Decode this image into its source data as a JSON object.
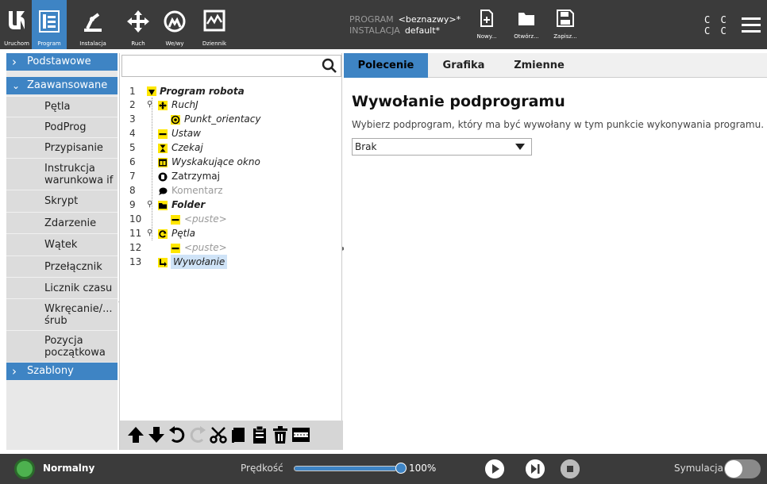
{
  "topbar": {
    "buttons": [
      {
        "label": "Uruchom",
        "icon": "ur-logo-icon"
      },
      {
        "label": "Program",
        "icon": "program-tree-icon",
        "active": true
      },
      {
        "label": "Instalacja",
        "icon": "robot-arm-icon"
      },
      {
        "label": "Ruch",
        "icon": "move-arrows-icon"
      },
      {
        "label": "We/wy",
        "icon": "io-icon"
      },
      {
        "label": "Dziennik",
        "icon": "log-icon"
      }
    ],
    "program_label": "PROGRAM",
    "program_value": "<beznazwy>*",
    "install_label": "INSTALACJA",
    "install_value": "default*",
    "new_label": "Nowy...",
    "open_label": "Otwórz...",
    "save_label": "Zapisz...",
    "cc_line1": "C C",
    "cc_line2": "C C"
  },
  "sidebar": {
    "categories": [
      "Podstawowe",
      "Zaawansowane",
      "Szablony"
    ],
    "items": [
      "Pętla",
      "PodProg",
      "Przypisanie",
      "Instrukcja warunkowa if",
      "Skrypt",
      "Zdarzenie",
      "Wątek",
      "Przełącznik",
      "Licznik czasu",
      "Wkręcanie/... śrub",
      "Pozycja początkowa"
    ]
  },
  "tree": {
    "rows": [
      {
        "num": "1",
        "label": "Program robota"
      },
      {
        "num": "2",
        "label": "RuchJ"
      },
      {
        "num": "3",
        "label": "Punkt_orientacy"
      },
      {
        "num": "4",
        "label": "Ustaw"
      },
      {
        "num": "5",
        "label": "Czekaj"
      },
      {
        "num": "6",
        "label": "Wyskakujące okno"
      },
      {
        "num": "7",
        "label": "Zatrzymaj"
      },
      {
        "num": "8",
        "label": "Komentarz"
      },
      {
        "num": "9",
        "label": "Folder"
      },
      {
        "num": "10",
        "label": "<puste>"
      },
      {
        "num": "11",
        "label": "Pętla"
      },
      {
        "num": "12",
        "label": "<puste>"
      },
      {
        "num": "13",
        "label": "Wywołanie"
      }
    ]
  },
  "right": {
    "tabs": [
      "Polecenie",
      "Grafika",
      "Zmienne"
    ],
    "title": "Wywołanie podprogramu",
    "description": "Wybierz podprogram, który ma być wywołany w tym punkcie wykonywania programu.",
    "select_value": "Brak"
  },
  "footer": {
    "status": "Normalny",
    "speed_label": "Prędkość",
    "speed_value": "100%",
    "speed_fraction": 1.0,
    "sim_label": "Symulacja"
  },
  "colors": {
    "accent": "#3e84c4",
    "bar": "#3b3b3b",
    "status_green": "#4db14f",
    "folder_yellow": "#ffe600"
  }
}
